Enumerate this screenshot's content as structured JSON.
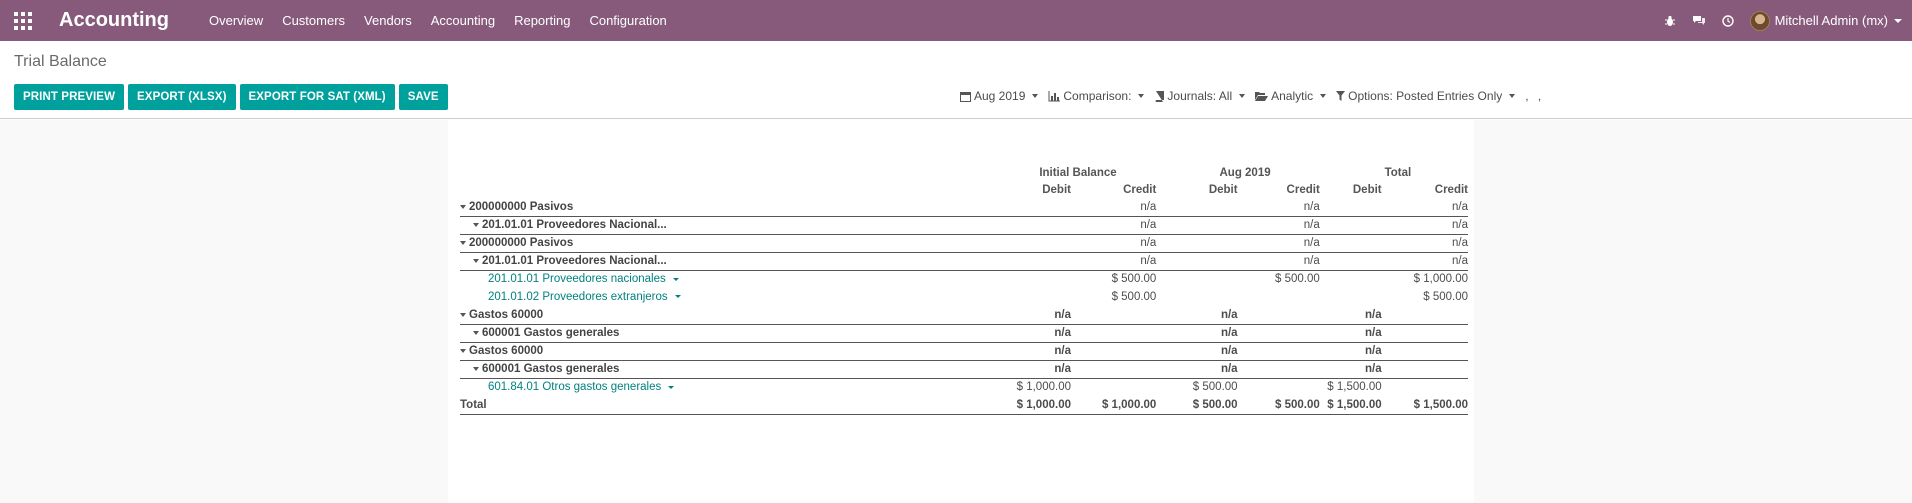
{
  "nav": {
    "brand": "Accounting",
    "menu": [
      "Overview",
      "Customers",
      "Vendors",
      "Accounting",
      "Reporting",
      "Configuration"
    ],
    "user": "Mitchell Admin (mx)",
    "icons": [
      "bug-icon",
      "chat-icon",
      "clock-icon"
    ]
  },
  "page": {
    "title": "Trial Balance",
    "buttons": [
      "PRINT PREVIEW",
      "EXPORT (XLSX)",
      "EXPORT FOR SAT (XML)",
      "SAVE"
    ],
    "filters": {
      "date": "Aug 2019",
      "comparison": "Comparison:",
      "journals": "Journals: All",
      "analytic": "Analytic",
      "options": "Options: Posted Entries Only",
      "extra": ", ,"
    }
  },
  "report": {
    "groups": [
      "Initial Balance",
      "Aug 2019",
      "Total"
    ],
    "subheaders": [
      "Debit",
      "Credit",
      "Debit",
      "Credit",
      "Debit",
      "Credit"
    ],
    "rows": [
      {
        "level": 0,
        "name": "200000000 Pasivos",
        "cells": [
          "",
          "n/a",
          "",
          "n/a",
          "",
          "n/a"
        ]
      },
      {
        "level": 1,
        "name": "201.01.01 Proveedores Nacional...",
        "cells": [
          "",
          "n/a",
          "",
          "n/a",
          "",
          "n/a"
        ]
      },
      {
        "level": 0,
        "name": "200000000 Pasivos",
        "cells": [
          "",
          "n/a",
          "",
          "n/a",
          "",
          "n/a"
        ]
      },
      {
        "level": 1,
        "name": "201.01.01 Proveedores Nacional...",
        "cells": [
          "",
          "n/a",
          "",
          "n/a",
          "",
          "n/a"
        ]
      },
      {
        "level": 2,
        "name": "201.01.01 Proveedores nacionales",
        "cells": [
          "",
          "$ 500.00",
          "",
          "$ 500.00",
          "",
          "$ 1,000.00"
        ]
      },
      {
        "level": 2,
        "name": "201.01.02 Proveedores extranjeros",
        "cells": [
          "",
          "$ 500.00",
          "",
          "",
          "",
          "$ 500.00"
        ]
      },
      {
        "level": 0,
        "name": "Gastos 60000",
        "cells": [
          "n/a",
          "",
          "n/a",
          "",
          "n/a",
          ""
        ]
      },
      {
        "level": 1,
        "name": "600001 Gastos generales",
        "cells": [
          "n/a",
          "",
          "n/a",
          "",
          "n/a",
          ""
        ]
      },
      {
        "level": 0,
        "name": "Gastos 60000",
        "cells": [
          "n/a",
          "",
          "n/a",
          "",
          "n/a",
          ""
        ]
      },
      {
        "level": 1,
        "name": "600001 Gastos generales",
        "cells": [
          "n/a",
          "",
          "n/a",
          "",
          "n/a",
          ""
        ]
      },
      {
        "level": 2,
        "name": "601.84.01 Otros gastos generales",
        "cells": [
          "$ 1,000.00",
          "",
          "$ 500.00",
          "",
          "$ 1,500.00",
          ""
        ]
      }
    ],
    "total": {
      "name": "Total",
      "cells": [
        "$ 1,000.00",
        "$ 1,000.00",
        "$ 500.00",
        "$ 500.00",
        "$ 1,500.00",
        "$ 1,500.00"
      ]
    }
  }
}
